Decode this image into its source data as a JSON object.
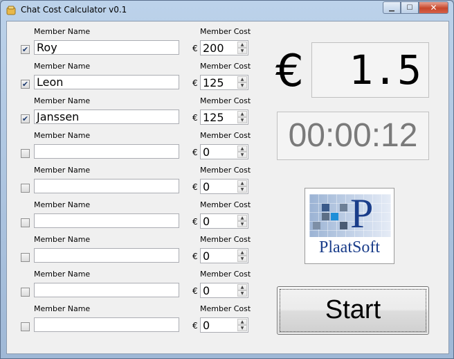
{
  "window": {
    "title": "Chat Cost Calculator v0.1",
    "close_glyph": "✕",
    "min_glyph": "▁",
    "max_glyph": "☐"
  },
  "labels": {
    "member_name": "Member Name",
    "member_cost": "Member Cost",
    "euro": "€"
  },
  "members": [
    {
      "checked": true,
      "name": "Roy",
      "cost": "200"
    },
    {
      "checked": true,
      "name": "Leon",
      "cost": "125"
    },
    {
      "checked": true,
      "name": "Janssen",
      "cost": "125"
    },
    {
      "checked": false,
      "name": "",
      "cost": "0"
    },
    {
      "checked": false,
      "name": "",
      "cost": "0"
    },
    {
      "checked": false,
      "name": "",
      "cost": "0"
    },
    {
      "checked": false,
      "name": "",
      "cost": "0"
    },
    {
      "checked": false,
      "name": "",
      "cost": "0"
    },
    {
      "checked": false,
      "name": "",
      "cost": "0"
    }
  ],
  "display": {
    "currency": "€",
    "cost": "1.5",
    "timer": "00:00:12"
  },
  "logo": {
    "text": "PlaatSoft",
    "letter": "P"
  },
  "start_button": {
    "label": "Start"
  },
  "colors": {
    "logo_blue": "#1a3d8a",
    "timer_gray": "#7a7a7a"
  }
}
